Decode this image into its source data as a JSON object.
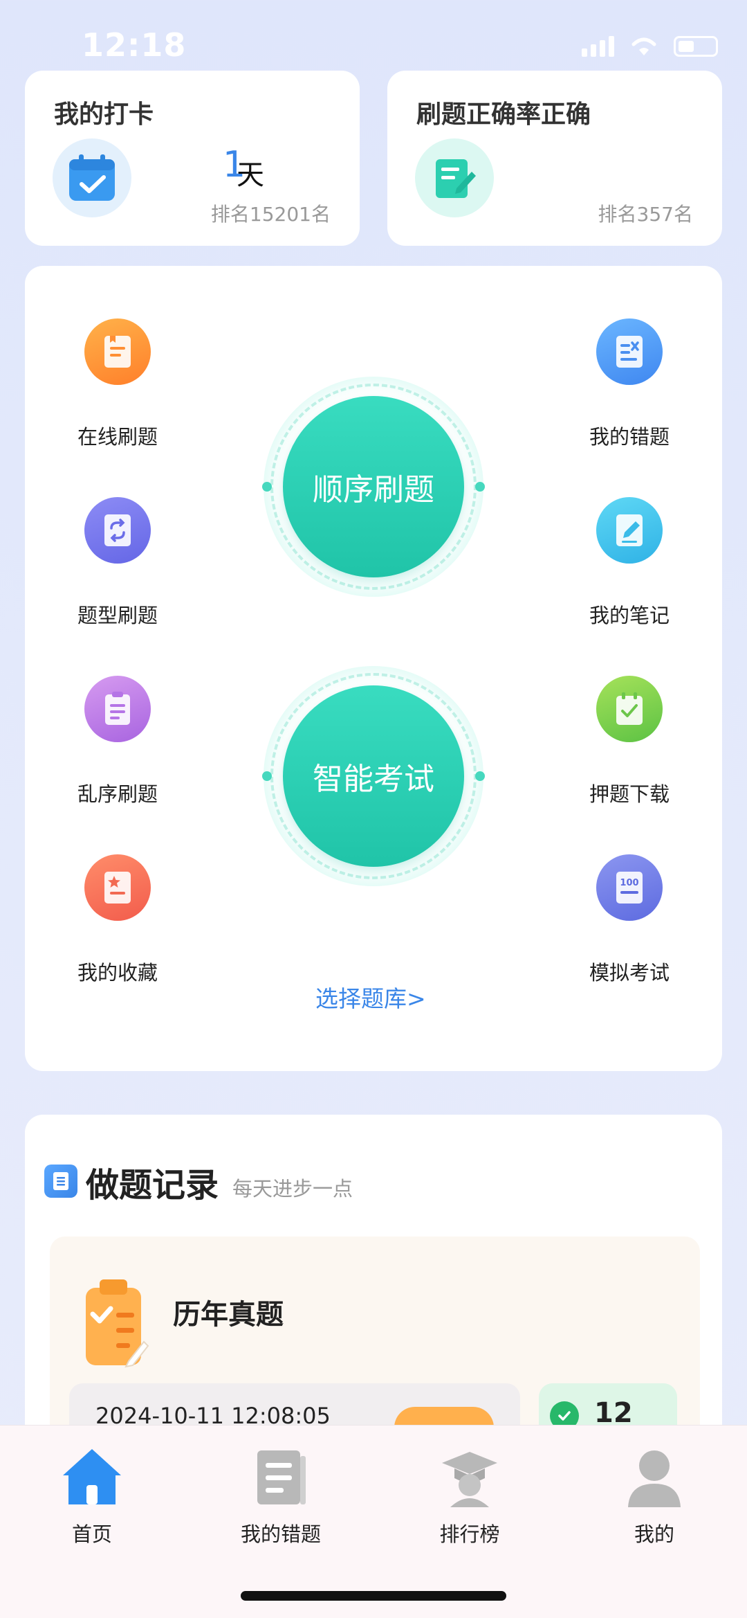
{
  "status_bar": {
    "time": "12:18"
  },
  "checkin_card": {
    "title": "我的打卡",
    "days": "1",
    "unit": "天",
    "rank": "排名15201名"
  },
  "accuracy_card": {
    "title": "刷题正确率正确",
    "rank": "排名357名"
  },
  "features": {
    "online": "在线刷题",
    "type": "题型刷题",
    "random": "乱序刷题",
    "favorites": "我的收藏",
    "wrong": "我的错题",
    "notes": "我的笔记",
    "predict": "押题下载",
    "mock": "模拟考试",
    "sequential": "顺序刷题",
    "smart_exam": "智能考试",
    "choose_bank": "选择题库>"
  },
  "record": {
    "title": "做题记录",
    "subtitle": "每天进步一点",
    "item_title": "历年真题",
    "date": "2024-10-11 12:08:05",
    "correct_count": "12"
  },
  "nav": {
    "home": "首页",
    "wrong": "我的错题",
    "ranking": "排行榜",
    "mine": "我的"
  },
  "colors": {
    "accent": "#3a86e8",
    "teal": "#20c4a8"
  }
}
